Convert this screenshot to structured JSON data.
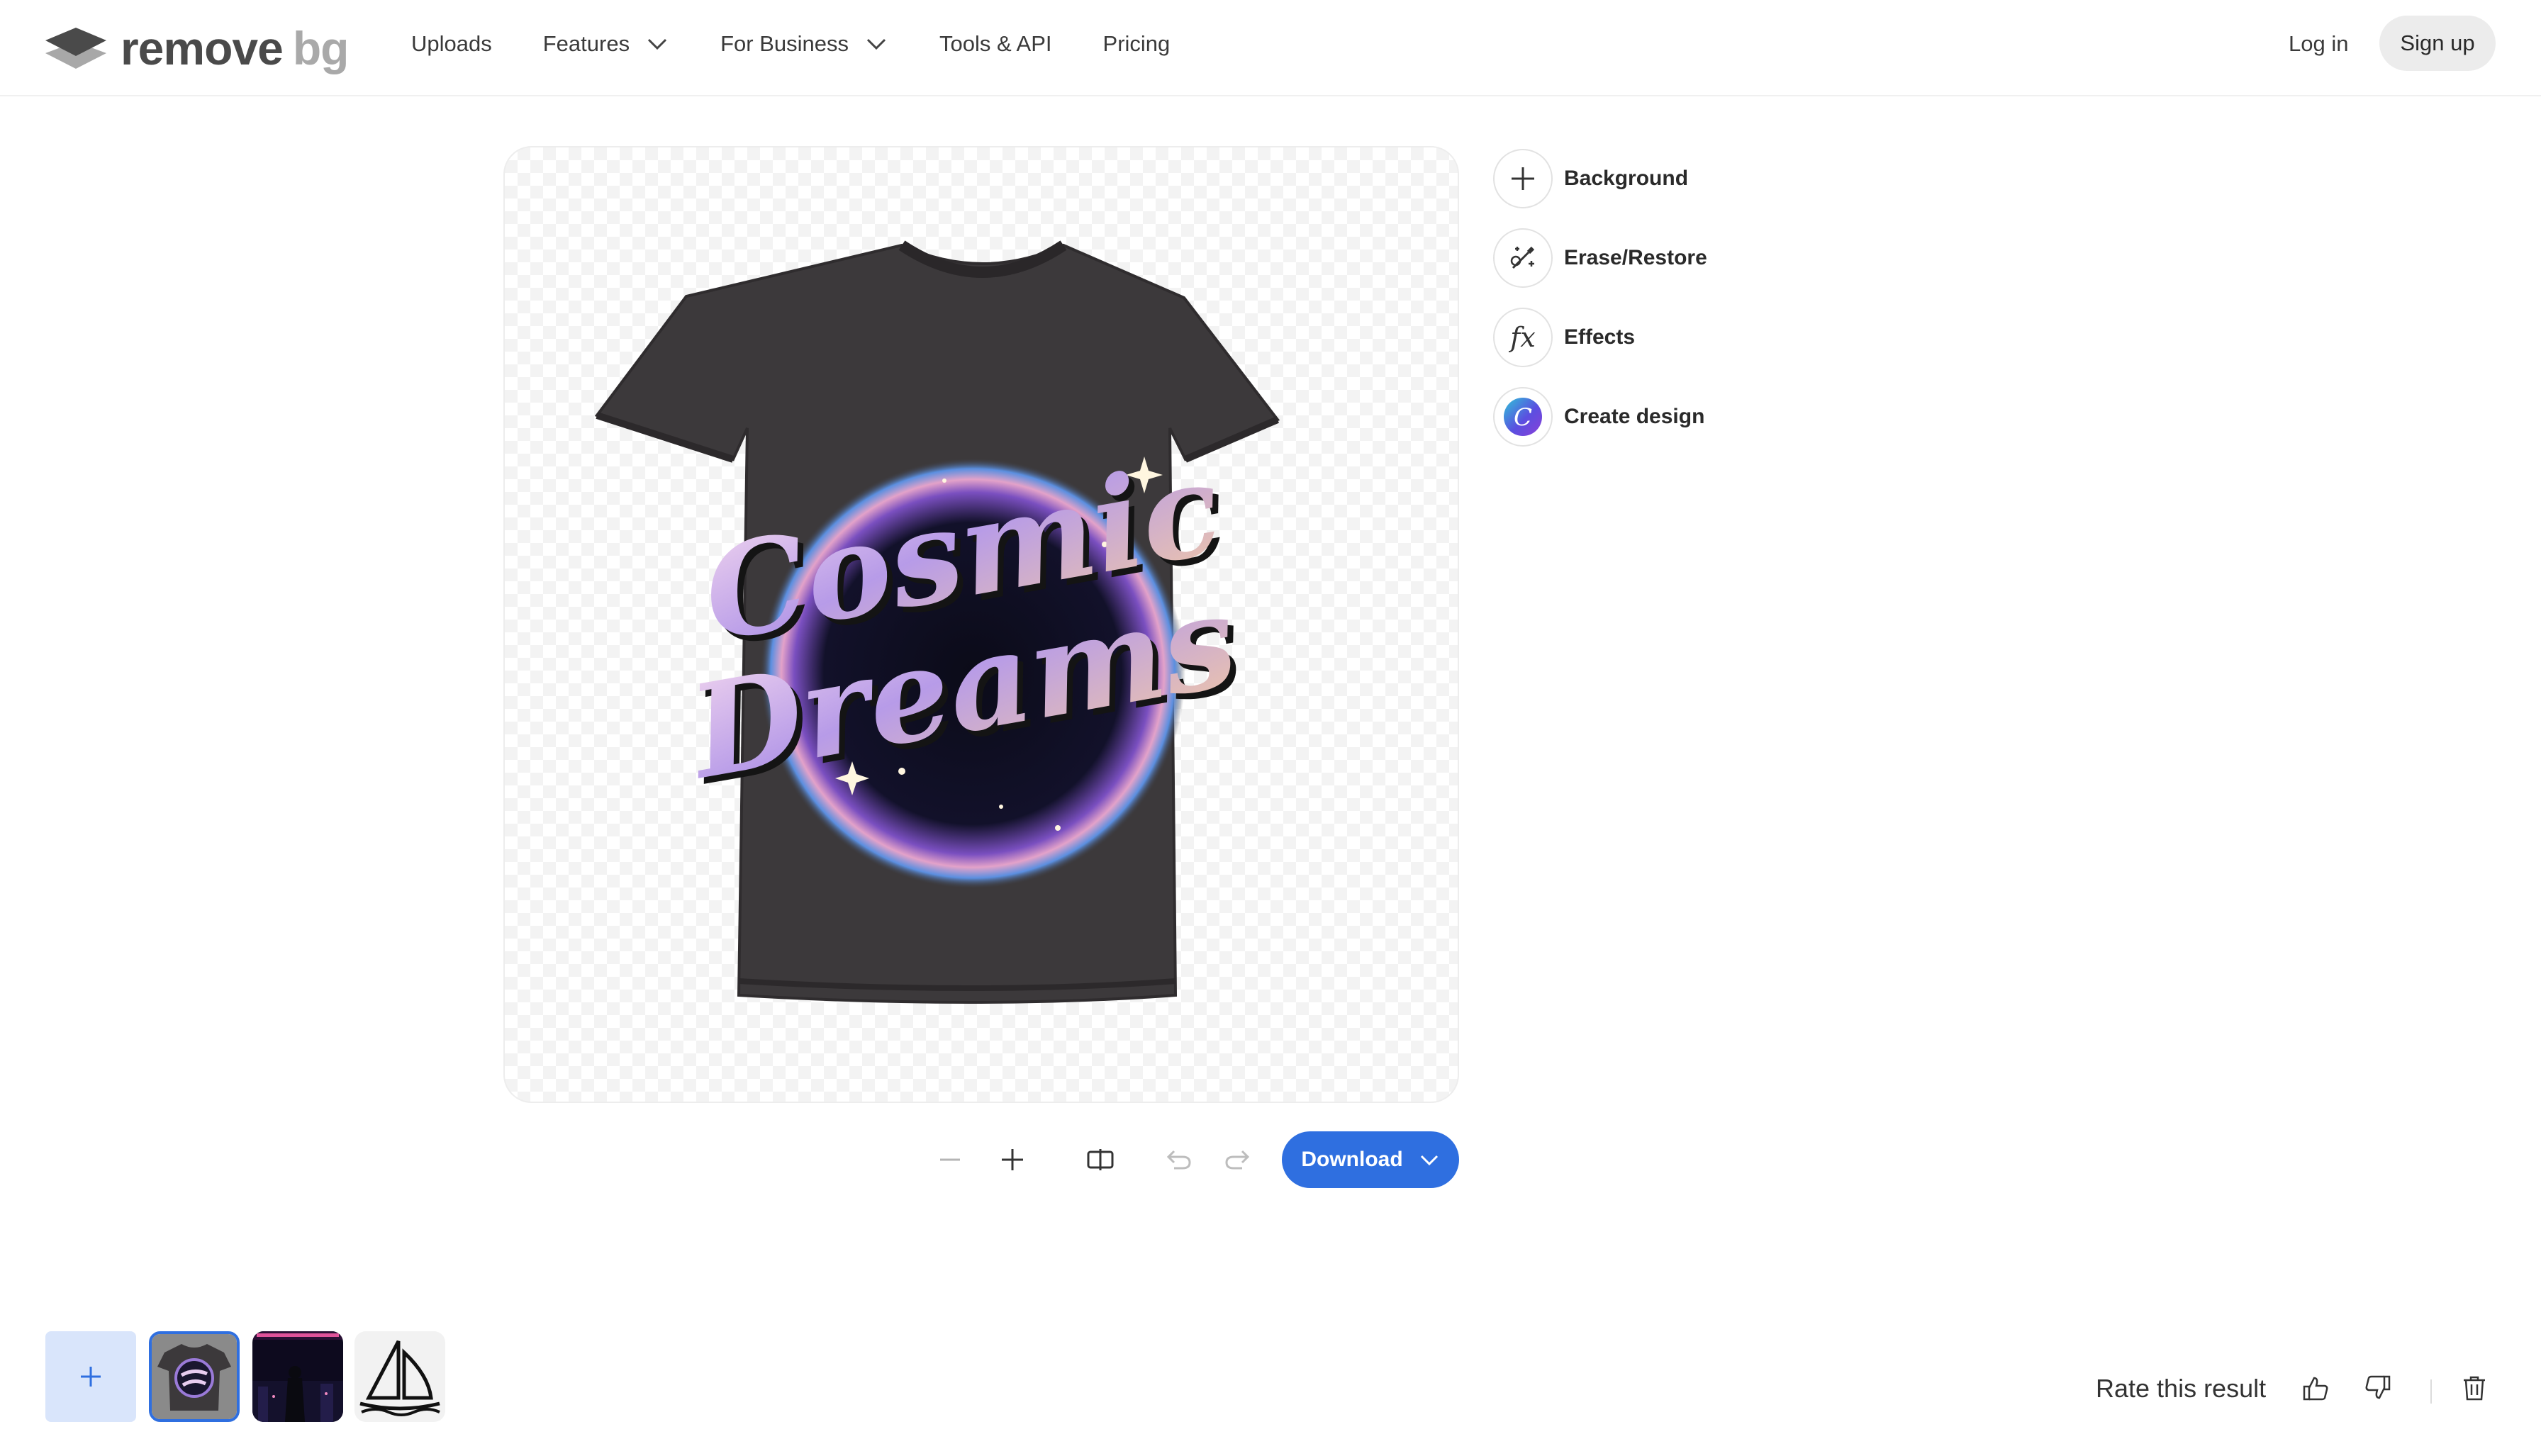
{
  "brand": {
    "name_part1": "remove",
    "name_part2": "bg"
  },
  "nav": {
    "items": [
      {
        "label": "Uploads",
        "dropdown": false
      },
      {
        "label": "Features",
        "dropdown": true
      },
      {
        "label": "For Business",
        "dropdown": true
      },
      {
        "label": "Tools & API",
        "dropdown": false
      },
      {
        "label": "Pricing",
        "dropdown": false
      }
    ],
    "login_label": "Log in",
    "signup_label": "Sign up"
  },
  "editor": {
    "image_text_line1": "Cosmic",
    "image_text_line2": "Dreams",
    "tools": [
      {
        "label": "Background",
        "icon": "plus-icon"
      },
      {
        "label": "Erase/Restore",
        "icon": "magic-brush-icon"
      },
      {
        "label": "Effects",
        "icon": "fx-icon"
      },
      {
        "label": "Create design",
        "icon": "canva-logo-icon"
      }
    ],
    "effects_glyph": "fx",
    "canva_glyph": "C",
    "download_label": "Download"
  },
  "footer": {
    "rate_label": "Rate this result",
    "thumbnails": [
      "cosmic-dreams-shirt",
      "dark-city-poster",
      "sailboat-drawing"
    ],
    "selected_thumbnail": 0
  },
  "colors": {
    "accent": "#2f6fe0",
    "add_tile": "#d9e5fb",
    "shirt": "#3c393b"
  }
}
